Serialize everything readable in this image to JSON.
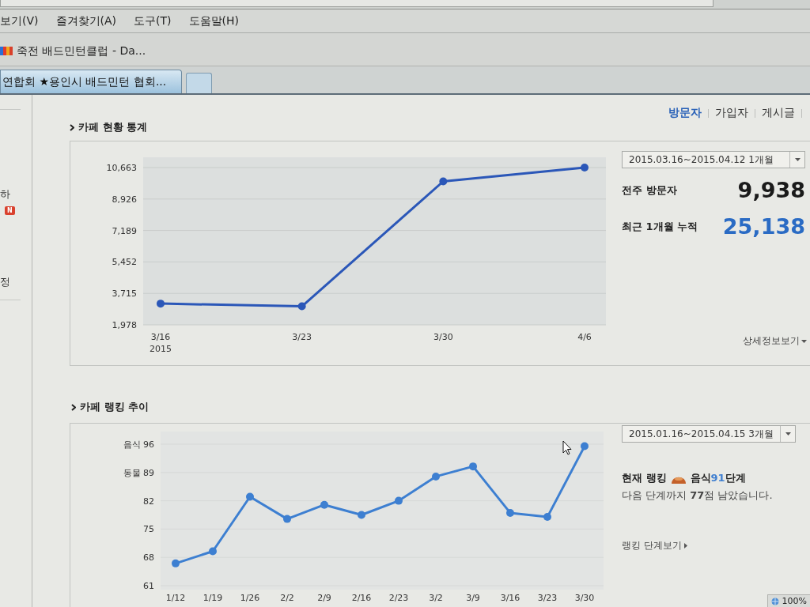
{
  "menu_bar": {
    "items": [
      "보기(V)",
      "즐겨찾기(A)",
      "도구(T)",
      "도움말(H)"
    ]
  },
  "favorites_bar": {
    "items": [
      {
        "title": "죽전 배드민턴클럽 - Da..."
      }
    ]
  },
  "tabs": [
    {
      "title": "연합회 ★용인시 배드민턴 협회...",
      "selected": true
    }
  ],
  "sidebar": {
    "items": [
      {
        "kind": "text",
        "text": "하"
      },
      {
        "kind": "badge",
        "text": "N"
      },
      {
        "kind": "text",
        "text": "정"
      }
    ]
  },
  "cafe_stats": {
    "title": "카페 현황 통계",
    "tabs": [
      {
        "label": "방문자",
        "selected": true
      },
      {
        "label": "가입자",
        "selected": false
      },
      {
        "label": "게시글",
        "selected": false
      }
    ],
    "chart_data": {
      "type": "line",
      "categories": [
        "3/16",
        "3/23",
        "3/30",
        "4/6"
      ],
      "series": [
        {
          "color": "#2b57b8",
          "marker": "circle",
          "values": [
            3150,
            3000,
            9900,
            10663
          ]
        }
      ],
      "ylim": [
        1978,
        10663
      ],
      "yticks": [
        {
          "value": 1978,
          "label": "1,978"
        },
        {
          "value": 3715,
          "label": "3,715"
        },
        {
          "value": 5452,
          "label": "5,452"
        },
        {
          "value": 7189,
          "label": "7,189"
        },
        {
          "value": 8926,
          "label": "8,926"
        },
        {
          "value": 10663,
          "label": "10,663"
        }
      ],
      "grid": true,
      "annotations": [
        "2015"
      ]
    },
    "period": "2015.03.16~2015.04.12 1개월",
    "metrics": [
      {
        "kind": "plain",
        "label": "전주 방문자",
        "value": "9,938"
      },
      {
        "kind": "accent",
        "label": "최근 1개월 누적",
        "value": "25,138"
      }
    ],
    "detail_link": "상세정보보기"
  },
  "cafe_ranking": {
    "title": "카페 랭킹 추이",
    "chart_data": {
      "type": "line",
      "categories": [
        "1/12",
        "1/19",
        "1/26",
        "2/2",
        "2/9",
        "2/16",
        "2/23",
        "3/2",
        "3/9",
        "3/16",
        "3/23",
        "3/30"
      ],
      "series": [
        {
          "color": "#3d7fd1",
          "marker": "circle",
          "values": [
            66.5,
            69.5,
            83,
            77.5,
            81,
            78.5,
            82,
            88,
            90.5,
            79,
            78,
            95.5
          ]
        }
      ],
      "ylim": [
        61,
        96
      ],
      "yticks": [
        61,
        68,
        75,
        82,
        {
          "value": 89,
          "label": "동물 89"
        },
        {
          "value": 96,
          "label": "음식 96"
        }
      ],
      "grid": true
    },
    "period": "2015.01.16~2015.04.15 3개월",
    "current_rank": {
      "label": "현재 랭킹",
      "category": "음식",
      "level": "91",
      "suffix": "단계"
    },
    "note": "다음 단계까지 **77**점 남았습니다.",
    "link": "랭킹 단계보기"
  },
  "status_bar": {
    "zoom": "100%"
  }
}
